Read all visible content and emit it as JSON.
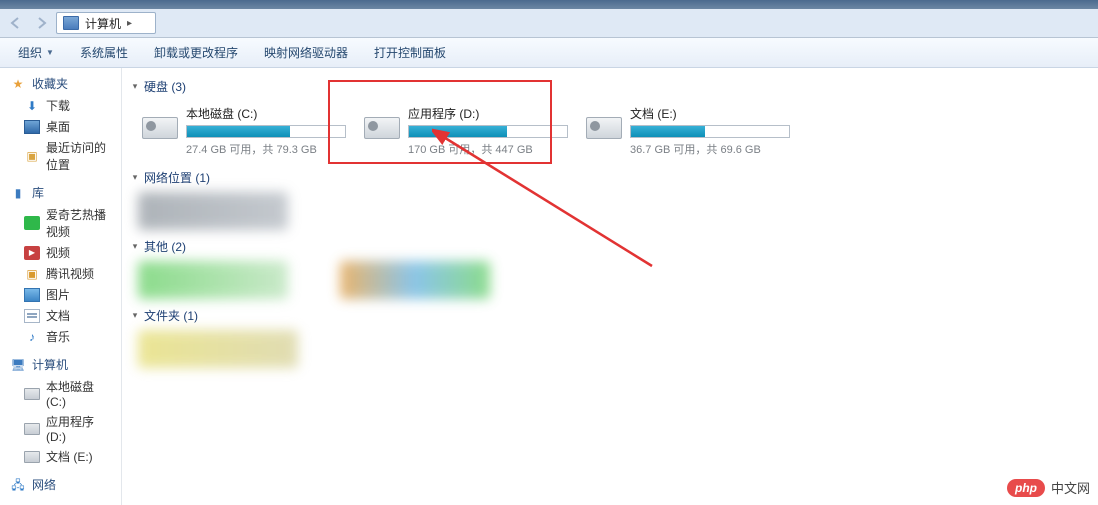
{
  "address": {
    "location": "计算机",
    "separator": "▸"
  },
  "toolbar": {
    "organize": "组织",
    "properties": "系统属性",
    "uninstall": "卸载或更改程序",
    "mapdrive": "映射网络驱动器",
    "controlpanel": "打开控制面板"
  },
  "sidebar": {
    "favorites": {
      "label": "收藏夹",
      "downloads": "下载",
      "desktop": "桌面",
      "recent": "最近访问的位置"
    },
    "libraries": {
      "label": "库",
      "iqiyi": "爱奇艺热播视频",
      "video": "视频",
      "tencent": "腾讯视频",
      "pictures": "图片",
      "documents": "文档",
      "music": "音乐"
    },
    "computer": {
      "label": "计算机",
      "c": "本地磁盘 (C:)",
      "d": "应用程序 (D:)",
      "e": "文档 (E:)"
    },
    "network": {
      "label": "网络"
    }
  },
  "groups": {
    "drives": {
      "title": "硬盘 (3)"
    },
    "netloc": {
      "title": "网络位置 (1)"
    },
    "other": {
      "title": "其他 (2)"
    },
    "folders": {
      "title": "文件夹 (1)"
    }
  },
  "drives": [
    {
      "name": "本地磁盘 (C:)",
      "stat": "27.4 GB 可用，共 79.3 GB",
      "fill_pct": 65
    },
    {
      "name": "应用程序 (D:)",
      "stat": "170 GB 可用，共 447 GB",
      "fill_pct": 62
    },
    {
      "name": "文档 (E:)",
      "stat": "36.7 GB 可用，共 69.6 GB",
      "fill_pct": 47
    }
  ],
  "watermark": {
    "pill": "php",
    "text": "中文网"
  },
  "colors": {
    "highlight": "#e23333"
  }
}
